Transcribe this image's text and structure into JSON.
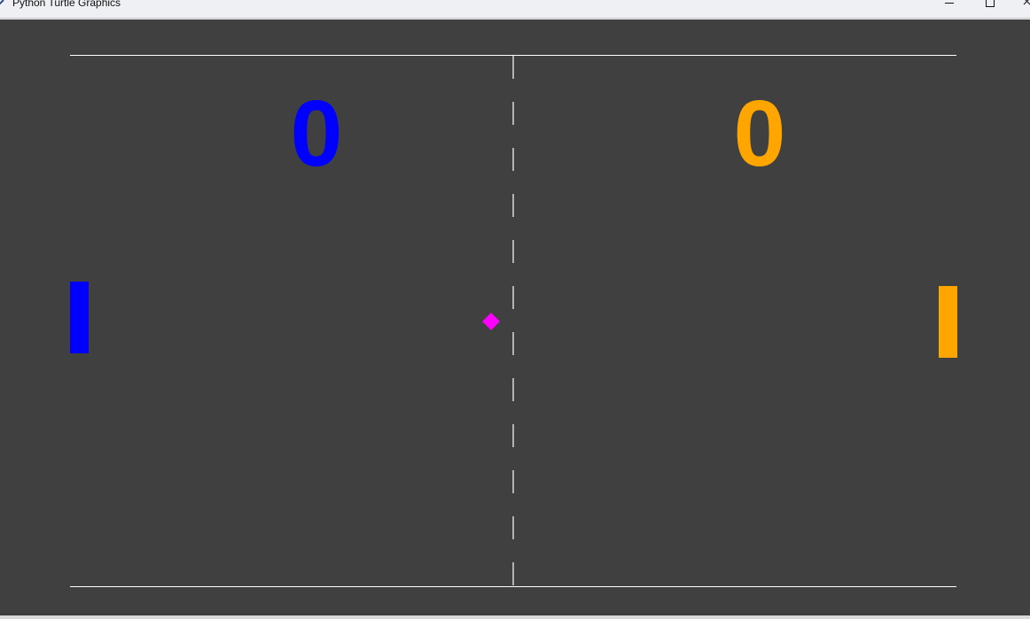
{
  "window": {
    "title": "Python Turtle Graphics",
    "icons": {
      "app": "turtle-app-icon",
      "minimize": "minimize-icon",
      "maximize": "maximize-icon",
      "close": "close-icon"
    }
  },
  "game": {
    "background_color": "#404040",
    "line_color": "#ffffff",
    "scores": {
      "left": "0",
      "right": "0"
    },
    "colors": {
      "left_player": "#0000ff",
      "right_player": "#ffa500",
      "ball": "#ff00ff"
    }
  }
}
